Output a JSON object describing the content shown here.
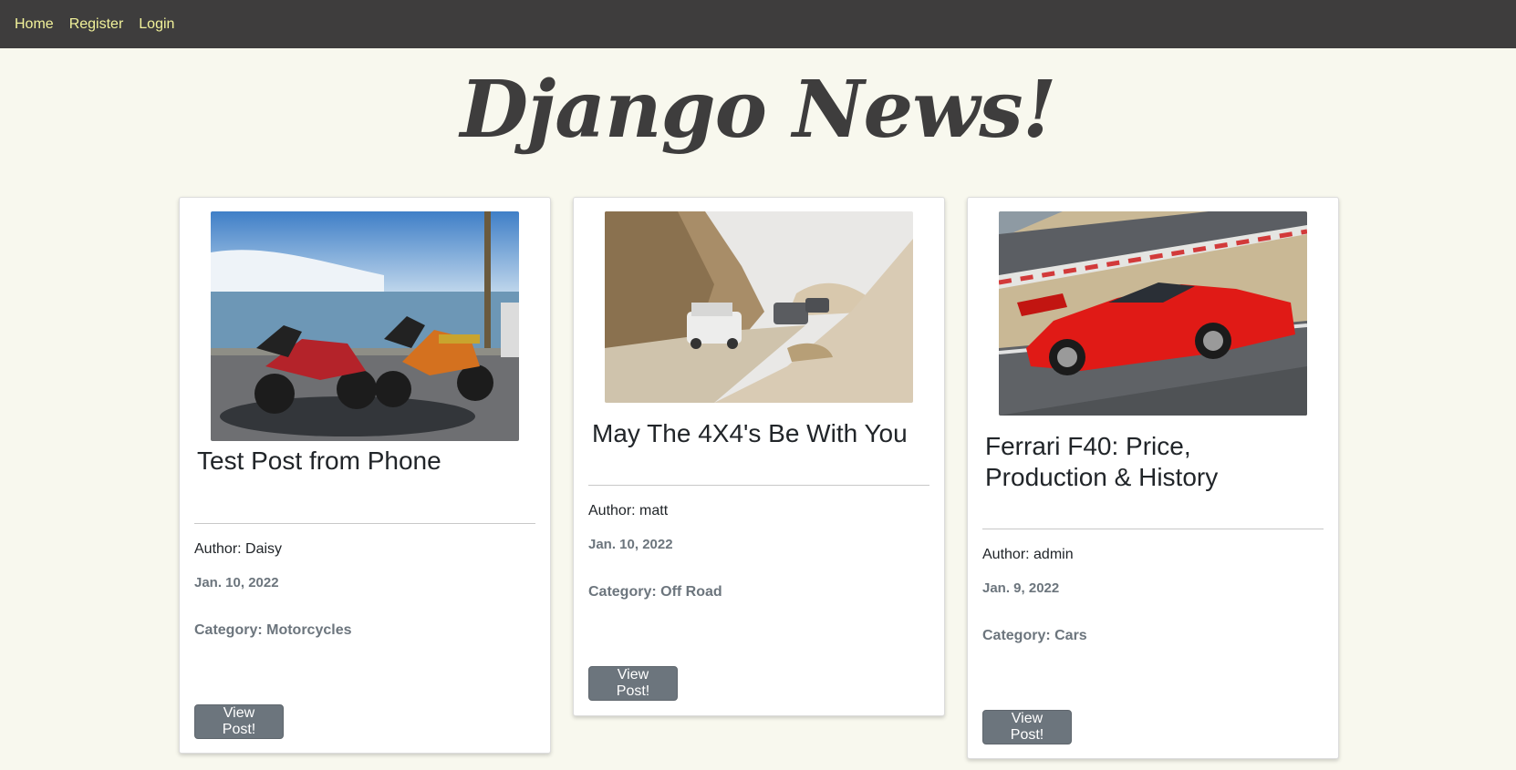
{
  "nav": {
    "home": "Home",
    "register": "Register",
    "login": "Login"
  },
  "site_title": "Django News!",
  "colors": {
    "navbar_bg": "#3e3d3d",
    "nav_link": "#f2f29a",
    "page_bg": "#f8f8ee",
    "button_bg": "#6c757d",
    "muted_text": "#6c757d"
  },
  "posts": [
    {
      "title": "Test Post from Phone",
      "author": "Author: Daisy",
      "date": "Jan. 10, 2022",
      "category": "Category: Motorcycles",
      "button": "View Post!",
      "image": "motorcycles-by-harbour-photo"
    },
    {
      "title": "May The 4X4's Be With You",
      "author": "Author: matt",
      "date": "Jan. 10, 2022",
      "category": "Category: Off Road",
      "button": "View Post!",
      "image": "off-road-convoy-photo"
    },
    {
      "title": "Ferrari F40: Price, Production & History",
      "author": "Author: admin",
      "date": "Jan. 9, 2022",
      "category": "Category: Cars",
      "button": "View Post!",
      "image": "red-ferrari-f40-photo"
    }
  ]
}
